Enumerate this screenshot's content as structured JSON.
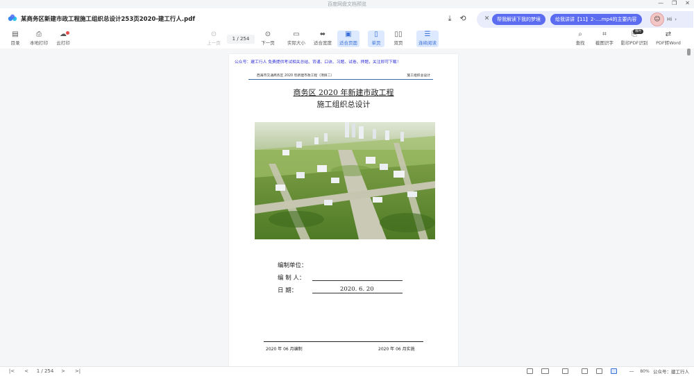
{
  "window": {
    "title": "百度网盘文档预览",
    "controls": [
      "—",
      "❐",
      "✕"
    ]
  },
  "header": {
    "document_title": "某商务区新建市政工程施工组织总设计253页2020-建工行人.pdf",
    "download_icon": "download-icon",
    "share_icon": "share-icon"
  },
  "ai_bar": {
    "suggestion1": "帮我解读下我的梦境",
    "suggestion2": "给我讲讲【11】2-....mp4的主要内容",
    "greeting": "Hi"
  },
  "toolbar": {
    "left": [
      {
        "label": "目录",
        "icon": "toc-icon"
      },
      {
        "label": "本地打印",
        "icon": "print-icon"
      },
      {
        "label": "云打印",
        "icon": "cloud-print-icon"
      }
    ],
    "prev_page": "上一页",
    "page_current": "1",
    "page_total": "/ 254",
    "next_page": "下一页",
    "actual_size": "实际大小",
    "fit_width": "适合宽度",
    "fit_page": "适合页面",
    "single_page": "单页",
    "double_page": "双页",
    "continuous": "连续阅读",
    "right": [
      {
        "label": "查找",
        "icon": "search-icon"
      },
      {
        "label": "截图识字",
        "icon": "screenshot-ocr-icon"
      },
      {
        "label": "影印PDF识别",
        "icon": "scan-pdf-icon"
      },
      {
        "label": "PDF转Word",
        "icon": "pdf-to-word-icon"
      }
    ],
    "free_badge": "限时"
  },
  "page": {
    "promo": "公众号：建工行人 免费提供考试相关总结、背诵、口诀、习题、试卷、押题，关注即可下载！",
    "header_left": "西海市交通商务区 2020 年新建市政工程（项目二）",
    "header_right": "施工组织总设计",
    "title_line1": "商务区 2020 年新建市政工程",
    "title_line2": "施工组织总设计",
    "field_unit": "编制单位：",
    "field_person": "编  制  人：",
    "field_date": "日      期：",
    "date_value": "2020. 6. 20",
    "footer_left": "2020 年 06 月编制",
    "footer_right": "2020 年 06 月实施"
  },
  "bottombar": {
    "first": "|<",
    "prev": "<",
    "page_indicator": "1 / 254",
    "next": ">",
    "last": ">|",
    "zoom_out": "—",
    "zoom": "80%",
    "zoom_in": "+"
  },
  "watermark": "公众号：建工行人"
}
